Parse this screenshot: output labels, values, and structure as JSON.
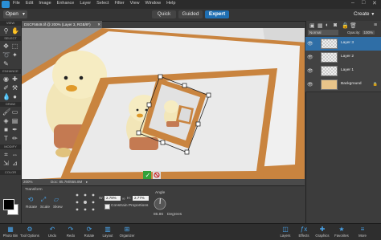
{
  "menu": [
    "File",
    "Edit",
    "Image",
    "Enhance",
    "Layer",
    "Select",
    "Filter",
    "View",
    "Window",
    "Help"
  ],
  "window_controls": [
    "–",
    "□",
    "✕"
  ],
  "modebar": {
    "open": "Open",
    "tabs": [
      "Quick",
      "Guided",
      "Expert"
    ],
    "active_tab": "Expert",
    "create": "Create"
  },
  "toolbox": {
    "sections": [
      "VIEW",
      "SELECT",
      "ENHANCE",
      "DRAW",
      "MODIFY",
      "COLOR"
    ]
  },
  "document": {
    "tab_title": "DSCF5849.tif @ 200% (Layer 3, RGB/8*)",
    "zoom": "200%",
    "doc_info": "Doc: 85.7M/655.8M"
  },
  "layers_panel": {
    "blend_mode": "Normal",
    "opacity_label": "Opacity:",
    "opacity_value": "100%",
    "layers": [
      {
        "name": "Layer 3",
        "selected": true
      },
      {
        "name": "Layer 2",
        "selected": false
      },
      {
        "name": "Layer 1",
        "selected": false
      },
      {
        "name": "Background",
        "selected": false
      }
    ]
  },
  "tool_options": {
    "section": "Transform",
    "buttons": [
      "Rotate",
      "Scale",
      "Skew"
    ],
    "w_label": "W:",
    "w_value": "2.78%",
    "h_label": "H:",
    "h_value": "2.77%",
    "constrain_label": "Constrain Proportions",
    "angle_label": "Angle",
    "angle_value": "86.86",
    "degrees_label": "Degrees"
  },
  "bottom_bar": {
    "left": [
      "Photo Bin",
      "Tool Options",
      "Undo",
      "Redo",
      "Rotate",
      "Layout",
      "Organizer"
    ],
    "right": [
      "Layers",
      "Effects",
      "Graphics",
      "Favorites",
      "More"
    ]
  },
  "colors": {
    "accent": "#1f6fb3",
    "icon_blue": "#4aa3e8",
    "frame_wood": "#c9843f",
    "commit_green": "#33a13a"
  }
}
